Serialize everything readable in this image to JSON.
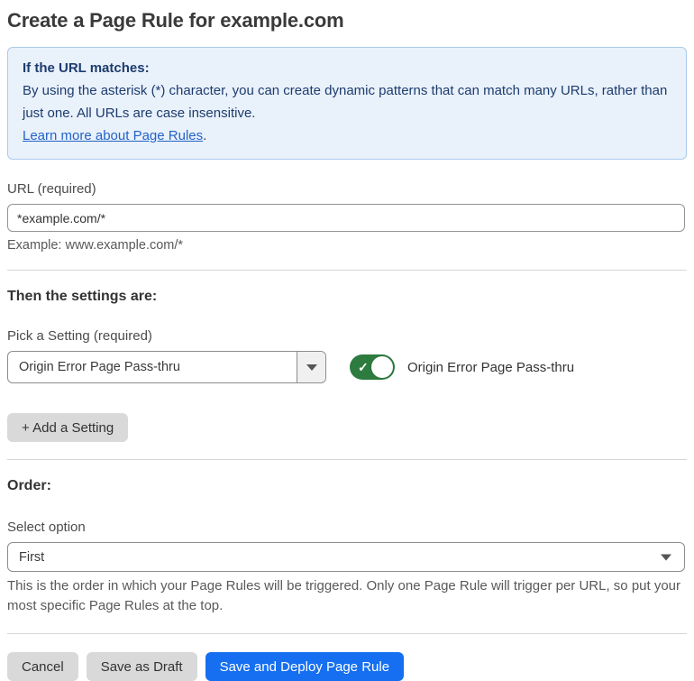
{
  "page": {
    "title": "Create a Page Rule for example.com"
  },
  "info_box": {
    "heading": "If the URL matches:",
    "body": "By using the asterisk (*) character, you can create dynamic patterns that can match many URLs, rather than just one. All URLs are case insensitive.",
    "link_label": "Learn more about Page Rules",
    "link_suffix": "."
  },
  "url_field": {
    "label": "URL (required)",
    "value": "*example.com/*",
    "helper": "Example: www.example.com/*"
  },
  "settings_section": {
    "heading": "Then the settings are:",
    "picker_label": "Pick a Setting (required)",
    "picker_value": "Origin Error Page Pass-thru",
    "toggle_state": "on",
    "toggle_check": "✓",
    "toggle_label": "Origin Error Page Pass-thru",
    "add_button_label": "+ Add a Setting"
  },
  "order_section": {
    "heading": "Order:",
    "select_label": "Select option",
    "select_value": "First",
    "helper": "This is the order in which your Page Rules will be triggered. Only one Page Rule will trigger per URL, so put your most specific Page Rules at the top."
  },
  "footer": {
    "cancel_label": "Cancel",
    "save_draft_label": "Save as Draft",
    "save_deploy_label": "Save and Deploy Page Rule"
  },
  "colors": {
    "info_bg": "#e9f1fb",
    "info_border": "#abcbeb",
    "info_text": "#1d3c6e",
    "link_blue": "#2363c5",
    "toggle_green": "#2e7b3f",
    "primary_blue": "#156ff0",
    "button_gray": "#d9d9d9"
  }
}
